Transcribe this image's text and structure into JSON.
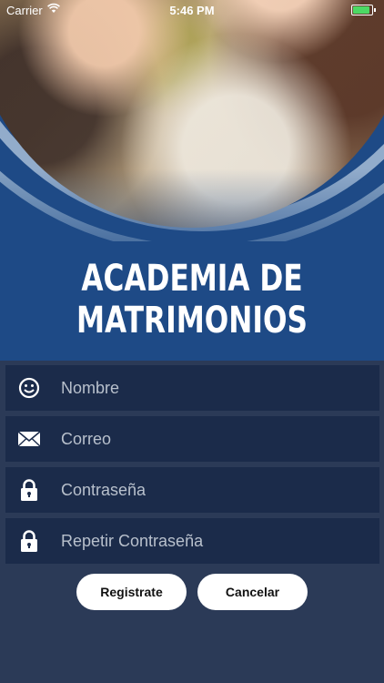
{
  "status_bar": {
    "carrier": "Carrier",
    "time": "5:46 PM",
    "battery_level": 1.0,
    "battery_color": "#4cd964"
  },
  "app": {
    "title_line1": "ACADEMIA DE",
    "title_line2": "MATRIMONIOS",
    "brand_color": "#1e4a86"
  },
  "form": {
    "fields": [
      {
        "icon": "smiley-icon",
        "placeholder": "Nombre",
        "value": ""
      },
      {
        "icon": "envelope-icon",
        "placeholder": "Correo",
        "value": ""
      },
      {
        "icon": "lock-icon",
        "placeholder": "Contraseña",
        "value": ""
      },
      {
        "icon": "lock-icon",
        "placeholder": "Repetir Contraseña",
        "value": ""
      }
    ],
    "register_label": "Registrate",
    "cancel_label": "Cancelar"
  }
}
